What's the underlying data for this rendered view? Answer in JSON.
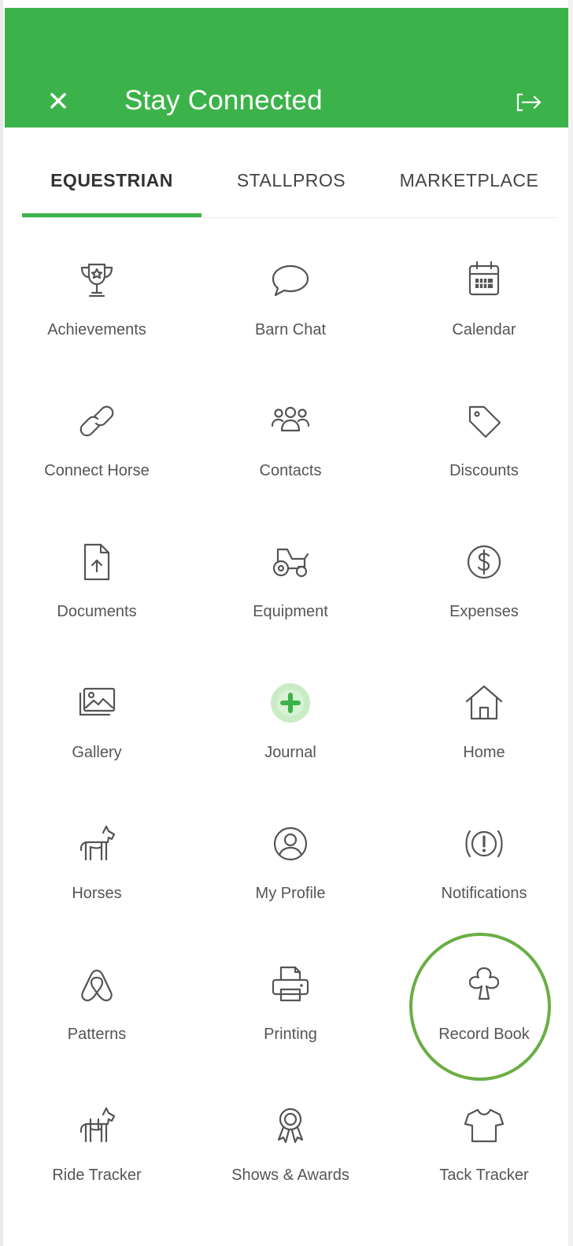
{
  "header": {
    "title": "Stay Connected",
    "background_color": "#3cb34a",
    "close_icon": "close-icon",
    "logout_icon": "logout-icon"
  },
  "tabs": [
    {
      "label": "EQUESTRIAN",
      "active": true
    },
    {
      "label": "STALLPROS",
      "active": false
    },
    {
      "label": "MARKETPLACE",
      "active": false
    }
  ],
  "menu": [
    {
      "label": "Achievements",
      "icon": "trophy-icon"
    },
    {
      "label": "Barn Chat",
      "icon": "chat-bubble-icon"
    },
    {
      "label": "Calendar",
      "icon": "calendar-icon"
    },
    {
      "label": "Connect Horse",
      "icon": "link-icon"
    },
    {
      "label": "Contacts",
      "icon": "contacts-icon"
    },
    {
      "label": "Discounts",
      "icon": "tag-icon"
    },
    {
      "label": "Documents",
      "icon": "document-upload-icon"
    },
    {
      "label": "Equipment",
      "icon": "tractor-icon"
    },
    {
      "label": "Expenses",
      "icon": "dollar-icon"
    },
    {
      "label": "Gallery",
      "icon": "gallery-icon"
    },
    {
      "label": "Journal",
      "icon": "add-journal-icon"
    },
    {
      "label": "Home",
      "icon": "home-icon"
    },
    {
      "label": "Horses",
      "icon": "horse-icon"
    },
    {
      "label": "My Profile",
      "icon": "profile-icon"
    },
    {
      "label": "Notifications",
      "icon": "notification-alert-icon"
    },
    {
      "label": "Patterns",
      "icon": "patterns-icon"
    },
    {
      "label": "Printing",
      "icon": "printer-icon"
    },
    {
      "label": "Record Book",
      "icon": "clover-icon",
      "highlighted": true
    },
    {
      "label": "Ride Tracker",
      "icon": "ride-tracker-icon"
    },
    {
      "label": "Shows & Awards",
      "icon": "award-ribbon-icon"
    },
    {
      "label": "Tack Tracker",
      "icon": "shirt-icon"
    }
  ],
  "colors": {
    "accent": "#3cb34a",
    "highlight_ring": "#6aae45",
    "journal_plus": "#3cb34a",
    "journal_plus_bg": "#c9ecc5"
  }
}
